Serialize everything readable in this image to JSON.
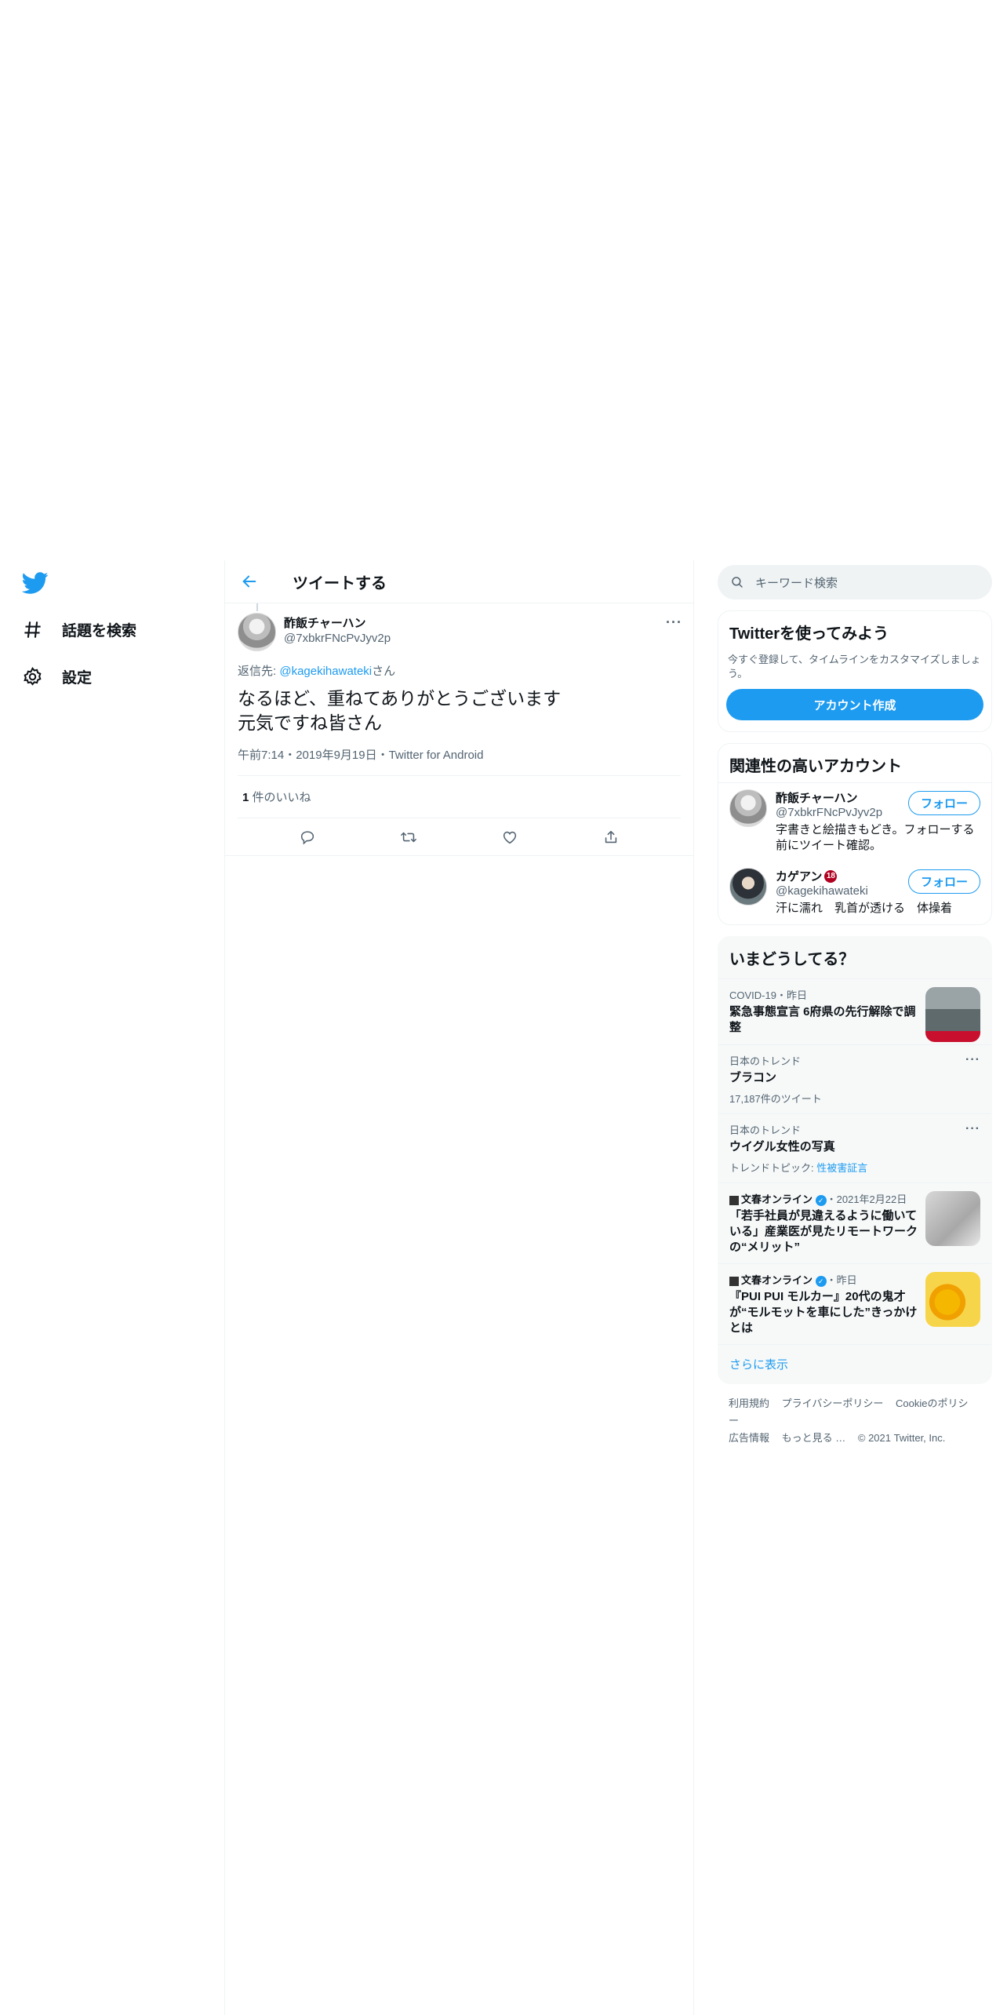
{
  "nav": {
    "explore_label": "話題を検索",
    "settings_label": "設定"
  },
  "header": {
    "title": "ツイートする"
  },
  "tweet": {
    "display_name": "酢飯チャーハン",
    "handle": "@7xbkrFNcPvJyv2p",
    "reply_prefix": "返信先: ",
    "reply_handle": "@kagekihawateki",
    "reply_suffix": "さん",
    "text_line1": "なるほど、重ねてありがとうございます",
    "text_line2": "元気ですね皆さん",
    "meta": "午前7:14・2019年9月19日・Twitter for Android",
    "like_count": "1",
    "like_label": " 件のいいね",
    "more": "···"
  },
  "sidebar": {
    "search_placeholder": "キーワード検索",
    "signup": {
      "title": "Twitterを使ってみよう",
      "text": "今すぐ登録して、タイムラインをカスタマイズしましょう。",
      "button": "アカウント作成"
    },
    "related": {
      "title": "関連性の高いアカウント",
      "follow_label": "フォロー",
      "accounts": [
        {
          "name": "酢飯チャーハン",
          "handle": "@7xbkrFNcPvJyv2p",
          "bio": "字書きと絵描きもどき。フォローする前にツイート確認。"
        },
        {
          "name": "カゲアン",
          "badge": "18",
          "handle": "@kagekihawateki",
          "bio": "汗に濡れ　乳首が透ける　体操着"
        }
      ]
    },
    "trends": {
      "title": "いまどうしてる？",
      "items": [
        {
          "category": "COVID-19・昨日",
          "title": "緊急事態宣言 6府県の先行解除で調整"
        },
        {
          "category": "日本のトレンド",
          "title": "ブラコン",
          "sub": "17,187件のツイート"
        },
        {
          "category": "日本のトレンド",
          "title": "ウイグル女性の写真",
          "sub_prefix": "トレンドトピック: ",
          "sub_link": "性被害証言"
        },
        {
          "publisher": "文春オンライン",
          "date": "・2021年2月22日",
          "title": "「若手社員が見違えるように働いている」産業医が見たリモートワークの“メリット”"
        },
        {
          "publisher": "文春オンライン",
          "date": "・昨日",
          "title": "『PUI PUI モルカー』20代の鬼才が“モルモットを車にした”きっかけとは"
        }
      ],
      "show_more": "さらに表示"
    },
    "footer": {
      "links": [
        "利用規約",
        "プライバシーポリシー",
        "Cookieのポリシー",
        "広告情報",
        "もっと見る …"
      ],
      "copyright": "© 2021 Twitter, Inc."
    }
  },
  "colors": {
    "accent": "#1d9bf0",
    "text": "#0f1419",
    "secondary": "#536471"
  }
}
